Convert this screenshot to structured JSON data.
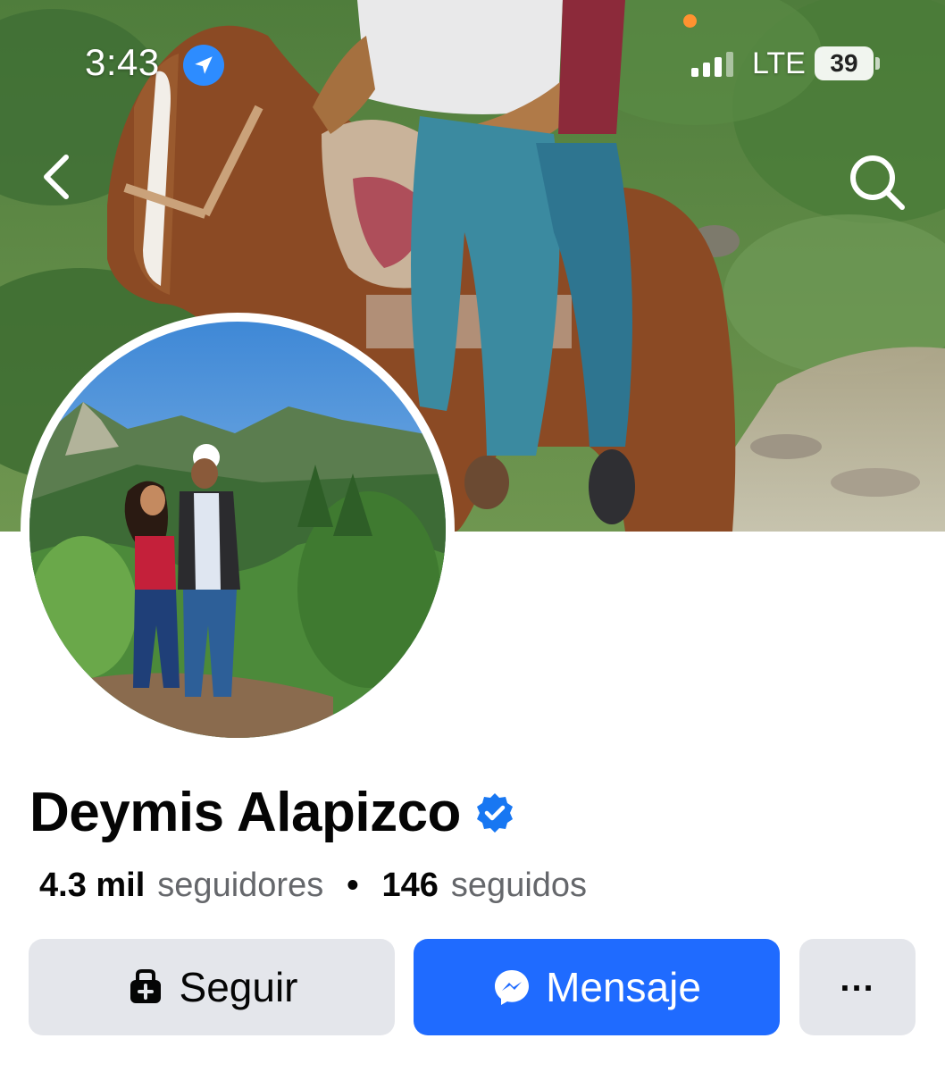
{
  "status_bar": {
    "time": "3:43",
    "network": "LTE",
    "battery": "39",
    "location_icon": "location-arrow-icon",
    "signal_icon": "signal-bars-icon"
  },
  "cover": {
    "back_icon": "chevron-left-icon",
    "search_icon": "search-icon"
  },
  "profile": {
    "name": "Deymis Alapizco",
    "verified_icon": "verified-badge-icon",
    "followers_count": "4.3 mil",
    "followers_label": "seguidores",
    "separator": "•",
    "following_count": "146",
    "following_label": "seguidos"
  },
  "actions": {
    "follow_label": "Seguir",
    "follow_icon": "follow-person-icon",
    "message_label": "Mensaje",
    "message_icon": "messenger-icon",
    "more_label": "...",
    "more_icon": "more-options-icon"
  },
  "colors": {
    "primary_blue": "#1f6bff",
    "verified_blue": "#1877f2",
    "secondary_button": "#e4e6eb",
    "muted_text": "#65676b"
  }
}
